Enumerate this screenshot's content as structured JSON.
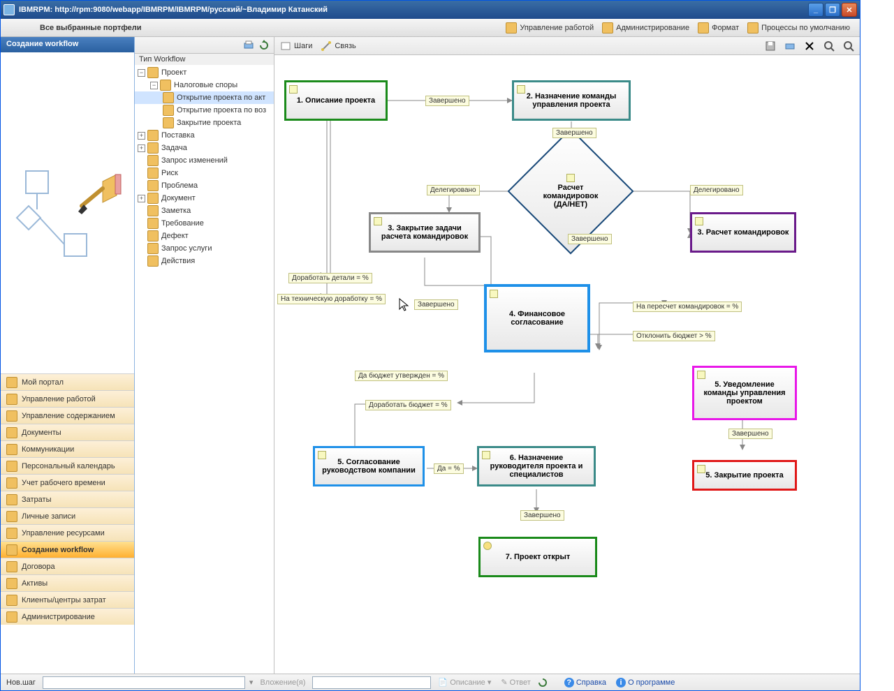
{
  "titlebar": {
    "title": "IBMRPM: http://rpm:9080/webapp/IBMRPM/IBMRPM/русский/~Владимир Катанский"
  },
  "top_toolbar": {
    "left": "Все выбранные портфели",
    "items": [
      "Управление работой",
      "Администрирование",
      "Формат",
      "Процессы по умолчанию"
    ]
  },
  "left_panel": {
    "header": "Создание workflow",
    "nav": [
      "Мой портал",
      "Управление работой",
      "Управление содержанием",
      "Документы",
      "Коммуникации",
      "Персональный календарь",
      "Учет рабочего времени",
      "Затраты",
      "Личные записи",
      "Управление ресурсами",
      "Создание workflow",
      "Договора",
      "Активы",
      "Клиенты/центры затрат",
      "Администрирование"
    ],
    "active_index": 10
  },
  "tree": {
    "header": "Тип Workflow",
    "root": "Проект",
    "group": "Налоговые споры",
    "children": [
      "Открытие проекта по акт",
      "Открытие проекта по воз",
      "Закрытие проекта"
    ],
    "selected_child_index": 0,
    "rest": [
      "Поставка",
      "Задача",
      "Запрос изменений",
      "Риск",
      "Проблема",
      "Документ",
      "Заметка",
      "Требование",
      "Дефект",
      "Запрос услуги",
      "Действия"
    ]
  },
  "canvas_toolbar": {
    "steps": "Шаги",
    "link": "Связь"
  },
  "nodes": {
    "n1": "1. Описание проекта",
    "n2": "2. Назначение команды управления проекта",
    "n3a": "3. Закрытие задачи расчета командировок",
    "n3b": "3. Расчет командировок",
    "n4": "4. Финансовое согласование",
    "n5a": "5. Согласование руководством компании",
    "n5b": "5. Уведомление команды управления проектом",
    "n5c": "5. Закрытие проекта",
    "n6": "6. Назначение руководителя проекта и специалистов",
    "n7": "7. Проект открыт",
    "d1a": "Расчет",
    "d1b": "командировок",
    "d1c": "(ДА/НЕТ)"
  },
  "edges": {
    "e1": "Завершено",
    "e2": "Завершено",
    "e3": "Делегировано",
    "e4": "Делегировано",
    "e5": "Завершено",
    "e6": "Доработать детали = %",
    "e7": "На техническую доработку = %",
    "e8": "Завершено",
    "e9": "На пересчет командировок = %",
    "e10": "Отклонить бюджет > %",
    "e11": "Да бюджет утвержден = %",
    "e12": "Доработать бюджет = %",
    "e13": "Да = %",
    "e14": "Завершено",
    "e15": "Завершено",
    "e16": "Завершено"
  },
  "footer": {
    "new_step": "Нов.шаг",
    "attach": "Вложение(я)",
    "desc": "Описание",
    "answer": "Ответ",
    "help": "Справка",
    "about": "О программе"
  },
  "colors": {
    "green": "#1a8a1a",
    "teal": "#3a8a88",
    "navy": "#184878",
    "gray": "#888",
    "blue": "#1e90e8",
    "magenta": "#e818e8",
    "red": "#e01818",
    "purple": "#6a1a8a"
  }
}
